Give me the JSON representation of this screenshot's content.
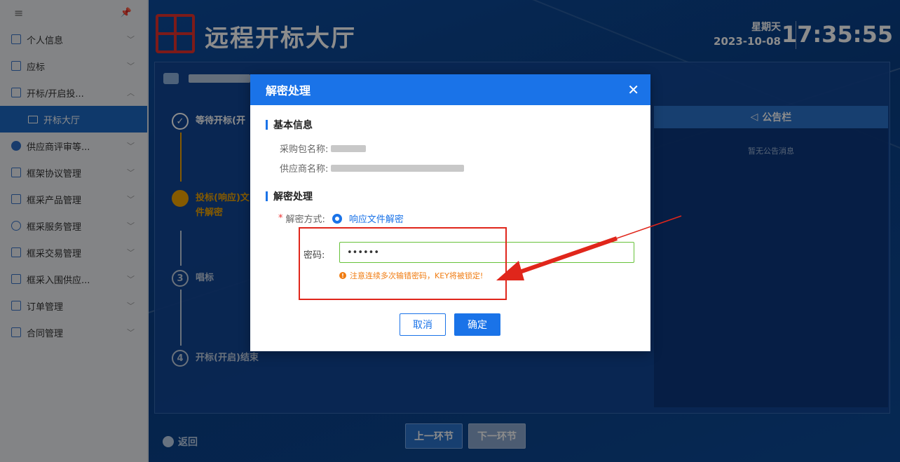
{
  "sidebar": {
    "items": [
      {
        "label": "个人信息",
        "chev": "﹀"
      },
      {
        "label": "应标",
        "chev": "﹀"
      },
      {
        "label": "开标/开启投...",
        "chev": "︿"
      },
      {
        "label": "开标大厅",
        "chev": ""
      },
      {
        "label": "供应商评审等...",
        "chev": "﹀"
      },
      {
        "label": "框架协议管理",
        "chev": "﹀"
      },
      {
        "label": "框采产品管理",
        "chev": "﹀"
      },
      {
        "label": "框采服务管理",
        "chev": "﹀"
      },
      {
        "label": "框采交易管理",
        "chev": "﹀"
      },
      {
        "label": "框采入围供应...",
        "chev": "﹀"
      },
      {
        "label": "订单管理",
        "chev": "﹀"
      },
      {
        "label": "合同管理",
        "chev": "﹀"
      }
    ]
  },
  "header": {
    "title": "远程开标大厅",
    "weekday": "星期天",
    "date": "2023-10-08",
    "time": "17:35:55"
  },
  "steps": [
    {
      "num": "✓",
      "label": "等待开标(开"
    },
    {
      "num": "✎",
      "label": "投标(响应)文",
      "label2": "件解密"
    },
    {
      "num": "3",
      "label": "唱标"
    },
    {
      "num": "4",
      "label": "开标(开启)结束"
    }
  ],
  "board": {
    "title": "公告栏",
    "empty": "暂无公告消息"
  },
  "footer": {
    "back": "返回",
    "prev": "上一环节",
    "next": "下一环节"
  },
  "modal": {
    "title": "解密处理",
    "basic_section": "基本信息",
    "package_label": "采购包名称:",
    "supplier_label": "供应商名称:",
    "decrypt_section": "解密处理",
    "method_label": "解密方式:",
    "method_option": "响应文件解密",
    "password_label": "密码:",
    "password_value": "••••••",
    "warning": "注意连续多次输错密码，KEY将被锁定!",
    "cancel": "取消",
    "confirm": "确定"
  },
  "colors": {
    "primary": "#1a73e8",
    "annotation": "#e0261b",
    "warning": "#f07c12",
    "valid_border": "#67c23a"
  }
}
